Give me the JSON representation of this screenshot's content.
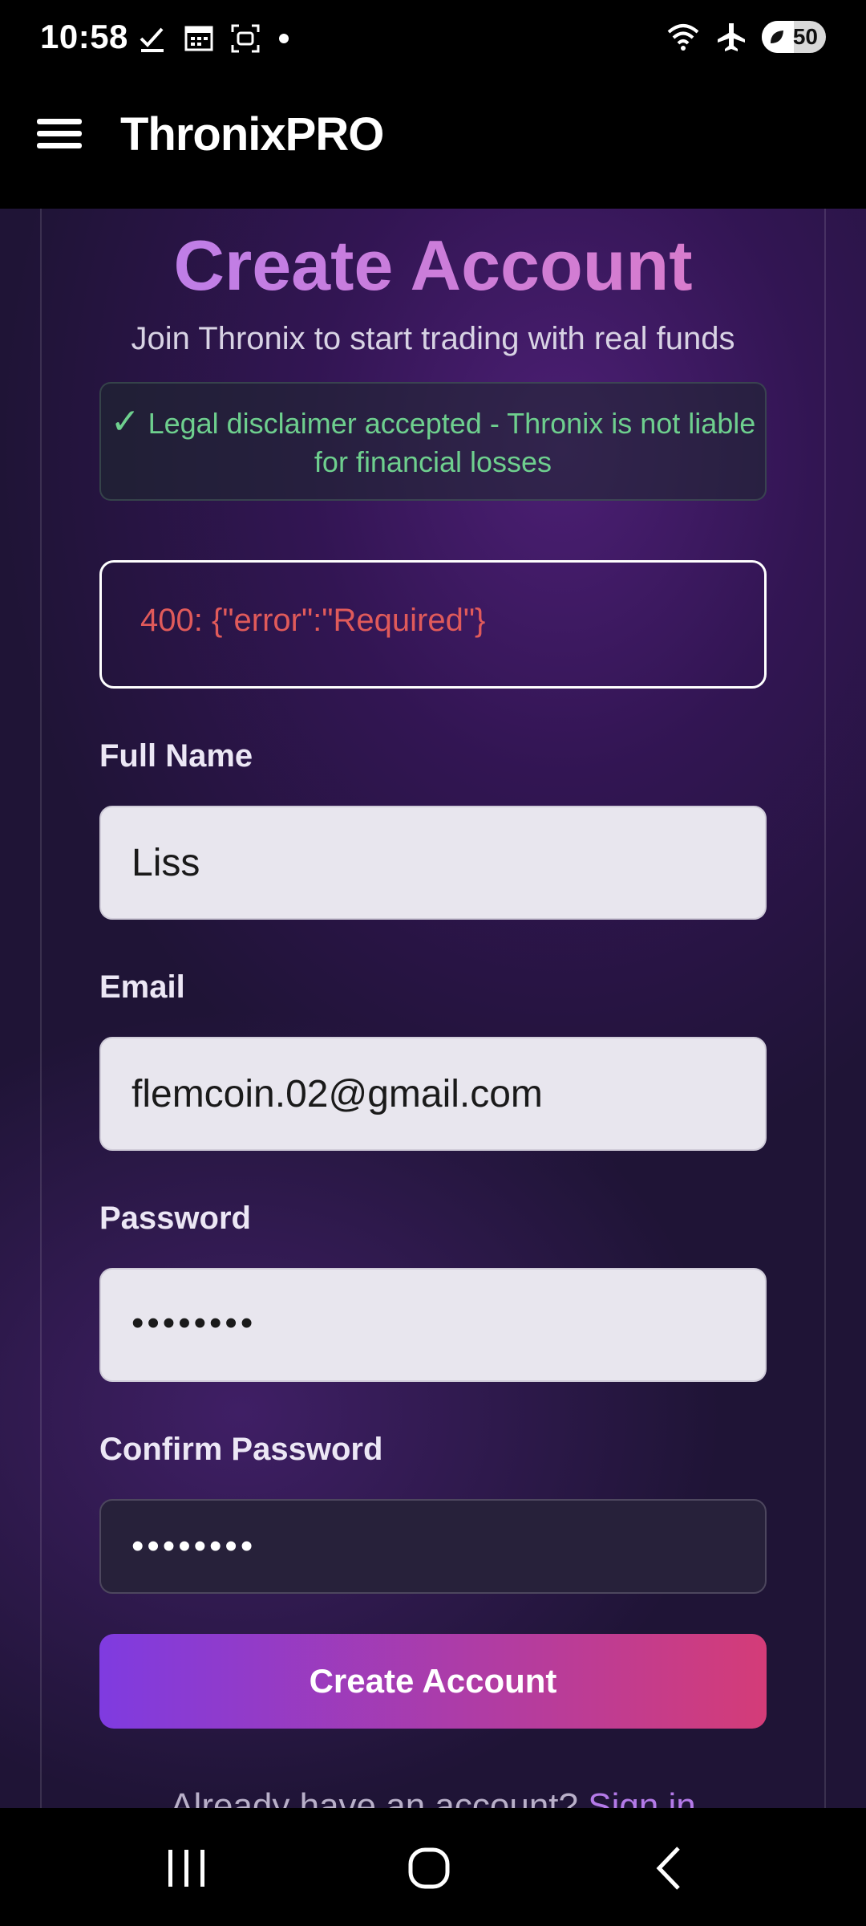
{
  "status_bar": {
    "time": "10:58",
    "battery": "50",
    "battery_level": 0.5,
    "icons_left": [
      "check-icon",
      "calendar-icon",
      "screenshot-icon",
      "notification-dot"
    ],
    "icons_right": [
      "wifi-icon",
      "airplane-mode-icon",
      "battery-icon"
    ]
  },
  "app_bar": {
    "title": "ThronixPRO",
    "menu_icon": "hamburger-menu-icon"
  },
  "form": {
    "heading": "Create Account",
    "subtitle": "Join Thronix to start trading with real funds",
    "disclaimer": {
      "check": "✓",
      "text": "Legal disclaimer accepted - Thronix is not liable for financial losses"
    },
    "error": "400: {\"error\":\"Required\"}",
    "fields": {
      "full_name": {
        "label": "Full Name",
        "value": "Liss"
      },
      "email": {
        "label": "Email",
        "value": "flemcoin.02@gmail.com"
      },
      "password": {
        "label": "Password",
        "value": "••••••••"
      },
      "confirm_password": {
        "label": "Confirm Password",
        "value": "••••••••"
      }
    },
    "submit_label": "Create Account",
    "signin_prompt": "Already have an account?",
    "signin_link": "Sign in"
  },
  "nav_bar": {
    "buttons": [
      "recent-apps-icon",
      "home-icon",
      "back-icon"
    ]
  },
  "colors": {
    "accent_purple": "#7f3be0",
    "accent_pink": "#d43c78",
    "error_red": "#e05a5a",
    "success_green": "#6ecf8e"
  }
}
